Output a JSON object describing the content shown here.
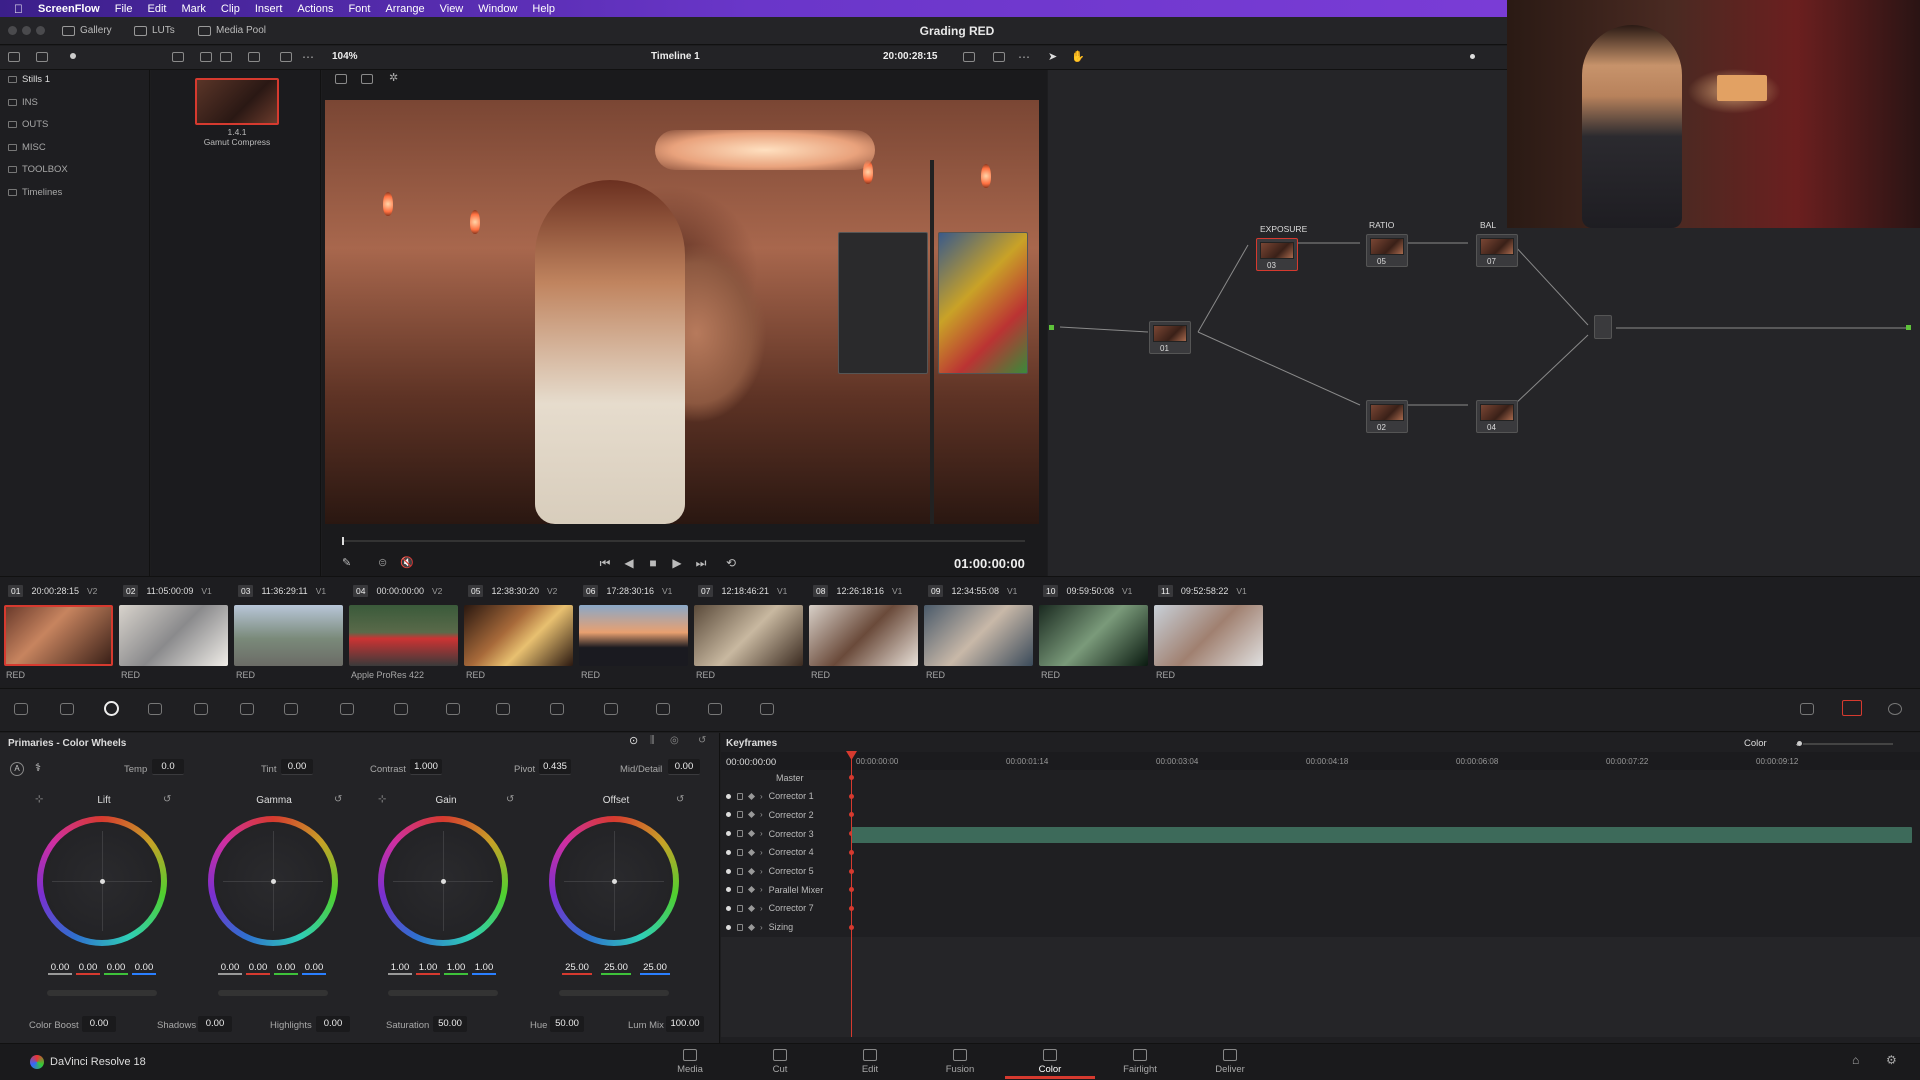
{
  "menubar": {
    "app": "ScreenFlow",
    "items": [
      "File",
      "Edit",
      "Mark",
      "Clip",
      "Insert",
      "Actions",
      "Font",
      "Arrange",
      "View",
      "Window",
      "Help"
    ]
  },
  "titlebar": {
    "tabs": [
      "Gallery",
      "LUTs",
      "Media Pool"
    ],
    "title": "Grading RED"
  },
  "toolbar": {
    "zoom": "104%",
    "timeline": "Timeline 1",
    "timecode": "20:00:28:15"
  },
  "sidebar": {
    "items": [
      "Stills 1",
      "INS",
      "OUTS",
      "MISC",
      "TOOLBOX",
      "Timelines"
    ]
  },
  "gallery": {
    "still_id": "1.4.1",
    "still_name": "Gamut Compress"
  },
  "viewer": {
    "timecode": "01:00:00:00"
  },
  "nodes": {
    "labels": [
      "EXPOSURE",
      "RATIO",
      "BAL"
    ],
    "ids": [
      "01",
      "02",
      "03",
      "04",
      "05",
      "07"
    ]
  },
  "clips": [
    {
      "num": "01",
      "tc": "20:00:28:15",
      "track": "V2",
      "codec": "RED"
    },
    {
      "num": "02",
      "tc": "11:05:00:09",
      "track": "V1",
      "codec": "RED"
    },
    {
      "num": "03",
      "tc": "11:36:29:11",
      "track": "V1",
      "codec": "RED"
    },
    {
      "num": "04",
      "tc": "00:00:00:00",
      "track": "V2",
      "codec": "Apple ProRes 422"
    },
    {
      "num": "05",
      "tc": "12:38:30:20",
      "track": "V2",
      "codec": "RED"
    },
    {
      "num": "06",
      "tc": "17:28:30:16",
      "track": "V1",
      "codec": "RED"
    },
    {
      "num": "07",
      "tc": "12:18:46:21",
      "track": "V1",
      "codec": "RED"
    },
    {
      "num": "08",
      "tc": "12:26:18:16",
      "track": "V1",
      "codec": "RED"
    },
    {
      "num": "09",
      "tc": "12:34:55:08",
      "track": "V1",
      "codec": "RED"
    },
    {
      "num": "10",
      "tc": "09:59:50:08",
      "track": "V1",
      "codec": "RED"
    },
    {
      "num": "11",
      "tc": "09:52:58:22",
      "track": "V1",
      "codec": "RED"
    }
  ],
  "primaries": {
    "title": "Primaries - Color Wheels",
    "params": [
      {
        "label": "Temp",
        "value": "0.0"
      },
      {
        "label": "Tint",
        "value": "0.00"
      },
      {
        "label": "Contrast",
        "value": "1.000"
      },
      {
        "label": "Pivot",
        "value": "0.435"
      },
      {
        "label": "Mid/Detail",
        "value": "0.00"
      }
    ],
    "wheels": [
      {
        "name": "Lift",
        "values": [
          "0.00",
          "0.00",
          "0.00",
          "0.00"
        ]
      },
      {
        "name": "Gamma",
        "values": [
          "0.00",
          "0.00",
          "0.00",
          "0.00"
        ]
      },
      {
        "name": "Gain",
        "values": [
          "1.00",
          "1.00",
          "1.00",
          "1.00"
        ]
      },
      {
        "name": "Offset",
        "values": [
          "25.00",
          "25.00",
          "25.00"
        ]
      }
    ],
    "bottom": [
      {
        "label": "Color Boost",
        "value": "0.00"
      },
      {
        "label": "Shadows",
        "value": "0.00"
      },
      {
        "label": "Highlights",
        "value": "0.00"
      },
      {
        "label": "Saturation",
        "value": "50.00"
      },
      {
        "label": "Hue",
        "value": "50.00"
      },
      {
        "label": "Lum Mix",
        "value": "100.00"
      }
    ]
  },
  "keyframes": {
    "title": "Keyframes",
    "mode": "Color",
    "start_tc": "00:00:00:00",
    "ruler": [
      "00:00:00:00",
      "00:00:01:14",
      "00:00:03:04",
      "00:00:04:18",
      "00:00:06:08",
      "00:00:07:22",
      "00:00:09:12"
    ],
    "rows": [
      "Master",
      "Corrector 1",
      "Corrector 2",
      "Corrector 3",
      "Corrector 4",
      "Corrector 5",
      "Parallel Mixer",
      "Corrector 7",
      "Sizing"
    ]
  },
  "pages": [
    "Media",
    "Cut",
    "Edit",
    "Fusion",
    "Color",
    "Fairlight",
    "Deliver"
  ],
  "brand": "DaVinci Resolve 18"
}
